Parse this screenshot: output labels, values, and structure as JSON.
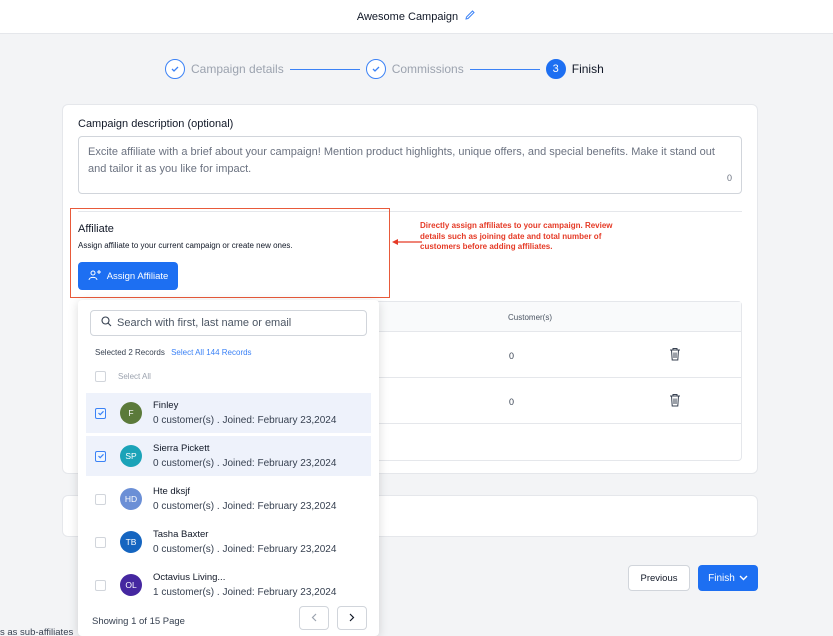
{
  "header": {
    "campaign_name": "Awesome Campaign"
  },
  "stepper": {
    "steps": [
      {
        "label": "Campaign details",
        "state": "done"
      },
      {
        "label": "Commissions",
        "state": "done"
      },
      {
        "label": "Finish",
        "state": "active",
        "number": "3"
      }
    ]
  },
  "description": {
    "label": "Campaign description (optional)",
    "placeholder": "Excite affiliate with a brief about your campaign! Mention product highlights, unique offers, and special benefits. Make it stand out and tailor it as you like for impact.",
    "char_count": "0"
  },
  "affiliate": {
    "title": "Affiliate",
    "subtitle": "Assign affiliate to your current campaign or create new ones.",
    "assign_button": "Assign Affiliate"
  },
  "annotation": "Directly assign affiliates to your campaign. Review details such as joining date and total number of customers before adding affiliates.",
  "table": {
    "customers_header": "Customer(s)",
    "rows": [
      {
        "customers": "0"
      },
      {
        "customers": "0"
      }
    ]
  },
  "dropdown": {
    "search_placeholder": "Search with first, last name or email",
    "selected_text": "Selected 2 Records",
    "select_all_link": "Select All 144 Records",
    "select_all_label": "Select All",
    "items": [
      {
        "initials": "F",
        "name": "Finley",
        "meta": "0 customer(s) . Joined: February 23,2024",
        "checked": true,
        "color": "#5b7a3a"
      },
      {
        "initials": "SP",
        "name": "Sierra Pickett",
        "meta": "0 customer(s) . Joined: February 23,2024",
        "checked": true,
        "color": "#1ba3b8"
      },
      {
        "initials": "HD",
        "name": "Hte dksjf",
        "meta": "0 customer(s) . Joined: February 23,2024",
        "checked": false,
        "color": "#6b8fd6"
      },
      {
        "initials": "TB",
        "name": "Tasha Baxter",
        "meta": "0 customer(s) . Joined: February 23,2024",
        "checked": false,
        "color": "#1565c0"
      },
      {
        "initials": "OL",
        "name": "Octavius Living...",
        "meta": "1 customer(s) . Joined: February 23,2024",
        "checked": false,
        "color": "#4527a0"
      }
    ],
    "page_info": "Showing 1 of 15 Page"
  },
  "footer": {
    "previous_label": "Previous",
    "finish_label": "Finish"
  },
  "cut_off_text": "s as sub-affiliates",
  "colors": {
    "primary": "#1d6ff2",
    "annotation_red": "#e53a26"
  }
}
